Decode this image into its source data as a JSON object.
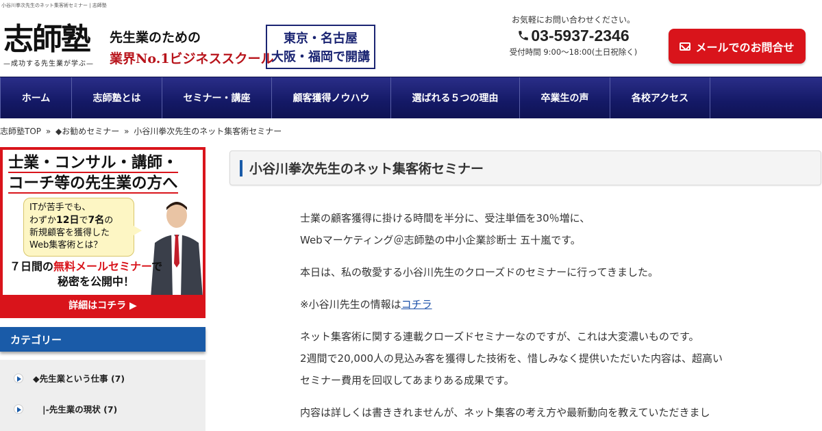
{
  "page": {
    "caption": "小谷川拳次先生のネット集客術セミナー | 志師塾"
  },
  "header": {
    "logo_text": "志師塾",
    "logo_sub": "—成功する先生業が学ぶ—",
    "tagline_1": "先生業のための",
    "tagline_2": "業界No.1ビジネススクール",
    "locations_1": "東京・名古屋",
    "locations_2": "大阪・福岡で開講",
    "contact_lead": "お気軽にお問い合わせください。",
    "phone": "03-5937-2346",
    "hours": "受付時間 9:00～18:00(土日祝除く)",
    "mail_button": "メールでのお問合せ"
  },
  "nav": {
    "items": [
      {
        "label": "ホーム"
      },
      {
        "label": "志師塾とは"
      },
      {
        "label": "セミナー・講座"
      },
      {
        "label": "顧客獲得ノウハウ"
      },
      {
        "label": "選ばれる５つの理由"
      },
      {
        "label": "卒業生の声"
      },
      {
        "label": "各校アクセス"
      }
    ]
  },
  "breadcrumb": {
    "home": "志師塾TOP",
    "sep": "»",
    "category": "◆お勧めセミナー",
    "current": "小谷川拳次先生のネット集客術セミナー"
  },
  "banner": {
    "title_1": "士業・コンサル・講師・",
    "title_2": "コーチ等の先生業の方へ",
    "bubble_1": "ITが苦手でも、",
    "bubble_2a": "わずか",
    "bubble_2b": "12日",
    "bubble_2c": "で",
    "bubble_2d": "7名",
    "bubble_2e": "の",
    "bubble_3": "新規顧客を獲得した",
    "bubble_4": "Web集客術とは？",
    "promo_a": "７日間の",
    "promo_b": "無料メールセミナー",
    "promo_c": "で",
    "promo_2": "秘密を公開中！",
    "footer": "詳細はコチラ ▶"
  },
  "sidebar": {
    "category_header": "カテゴリー",
    "categories": [
      {
        "label": "◆先生業という仕事 (7)"
      },
      {
        "label": "|-先生業の現状 (7)"
      }
    ]
  },
  "main": {
    "title": "小谷川拳次先生のネット集客術セミナー",
    "p1_l1": "士業の顧客獲得に掛ける時間を半分に、受注単価を30％増に、",
    "p1_l2": "Webマーケティング＠志師塾の中小企業診断士 五十嵐です。",
    "p2": "本日は、私の敬愛する小谷川先生のクローズドのセミナーに行ってきました。",
    "p3_prefix": "※小谷川先生の情報は",
    "p3_link": "コチラ",
    "p4_l1": "ネット集客術に関する連載クローズドセミナーなのですが、これは大変濃いものです。",
    "p4_l2": "2週間で20,000人の見込み客を獲得した技術を、惜しみなく提供いただいた内容は、超高い",
    "p4_l3": "セミナー費用を回収してあまりある成果です。",
    "p5_l1": "内容は詳しくは書ききれませんが、ネット集客の考え方や最新動向を教えていただきまし"
  },
  "colors": {
    "nav_bg": "#141966",
    "accent_red": "#d9141b",
    "category_blue": "#1a5ba8",
    "link": "#1a4fa8"
  },
  "icons": {
    "phone": "phone-icon",
    "mail": "mail-icon",
    "category_arrow": "chevron-right-icon"
  }
}
